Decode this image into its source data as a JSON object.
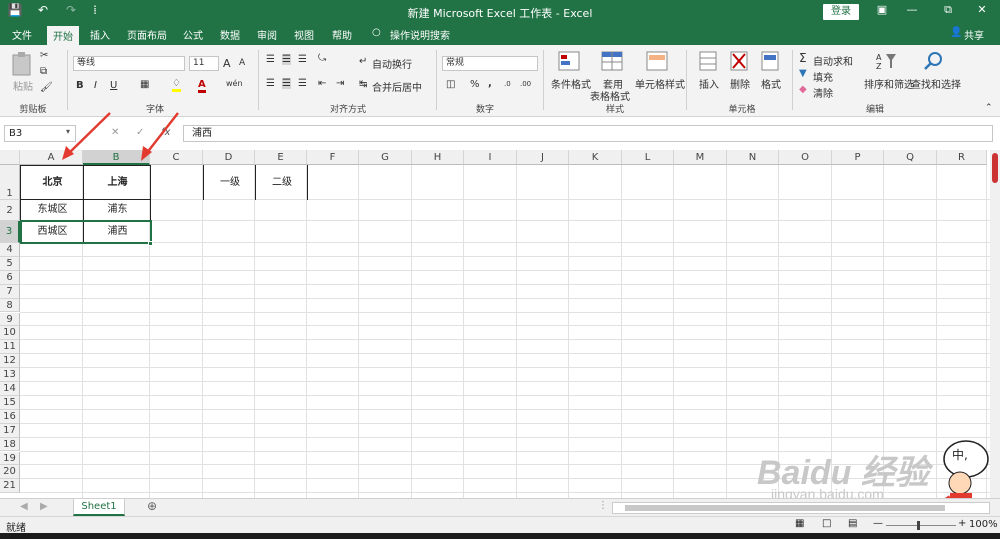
{
  "window": {
    "title": "新建 Microsoft Excel 工作表 - Excel",
    "login_label": "登录",
    "share_label": "共享"
  },
  "tabs": [
    "文件",
    "开始",
    "插入",
    "页面布局",
    "公式",
    "数据",
    "审阅",
    "视图",
    "帮助"
  ],
  "tell_me": "操作说明搜索",
  "ribbon": {
    "clipboard": {
      "paste_label": "粘贴",
      "group_label": "剪贴板"
    },
    "font": {
      "font_name": "等线",
      "font_size": "11",
      "grow": "A",
      "shrink": "A",
      "bold": "B",
      "italic": "I",
      "underline": "U",
      "font_color_letter": "A",
      "phonetic": "wén",
      "group_label": "字体"
    },
    "alignment": {
      "wrap_text": "自动换行",
      "merge_center": "合并后居中",
      "group_label": "对齐方式"
    },
    "number": {
      "format": "常规",
      "percent": "%",
      "comma": ",",
      "group_label": "数字"
    },
    "styles": {
      "conditional": "条件格式",
      "table_format_line1": "套用",
      "table_format_line2": "表格格式",
      "cell_styles": "单元格样式",
      "group_label": "样式"
    },
    "cells": {
      "insert": "插入",
      "delete": "删除",
      "format": "格式",
      "group_label": "单元格"
    },
    "editing": {
      "autosum": "自动求和",
      "fill": "填充",
      "clear": "清除",
      "sort_filter": "排序和筛选",
      "find_select": "查找和选择",
      "group_label": "编辑"
    }
  },
  "formula_bar": {
    "name_box": "B3",
    "fx_label": "fx",
    "content": "浦西"
  },
  "columns": [
    "A",
    "B",
    "C",
    "D",
    "E",
    "F",
    "G",
    "H",
    "I",
    "J",
    "K",
    "L",
    "M",
    "N",
    "O",
    "P",
    "Q",
    "R"
  ],
  "rows": [
    "1",
    "2",
    "3",
    "4",
    "5",
    "6",
    "7",
    "8",
    "9",
    "10",
    "11",
    "12",
    "13",
    "14",
    "15",
    "16",
    "17",
    "18",
    "19",
    "20",
    "21"
  ],
  "cells": {
    "A1": "北京",
    "B1": "上海",
    "A2": "东城区",
    "B2": "浦东",
    "A3": "西城区",
    "B3": "浦西",
    "D1": "一级",
    "E1": "二级"
  },
  "selected_cell": "B3",
  "sheet_tab": "Sheet1",
  "status": {
    "ready": "就绪",
    "zoom": "100%"
  },
  "watermark": {
    "brand": "Baidu 经验",
    "url": "jingyan.baidu.com"
  },
  "colors": {
    "excel_green": "#217346",
    "arrow_red": "#e23a2f"
  }
}
